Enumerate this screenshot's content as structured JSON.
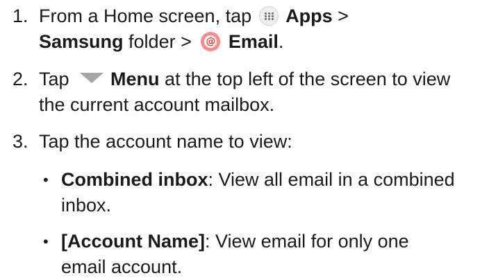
{
  "steps": [
    {
      "number": "1.",
      "line1": {
        "t1": "From a Home screen, tap ",
        "apps_label": "Apps",
        "t2": " >"
      },
      "line2": {
        "samsung_label": "Samsung",
        "t3": " folder > ",
        "email_label": "Email",
        "t4": "."
      },
      "icons": [
        "apps-grid-icon",
        "email-at-icon"
      ]
    },
    {
      "number": "2.",
      "line1": {
        "t1": "Tap ",
        "menu_label": "Menu",
        "t2": " at the top left of the screen to view"
      },
      "line2": "the current account mailbox.",
      "icons": [
        "menu-triangle-icon"
      ]
    },
    {
      "number": "3.",
      "line1": "Tap the account name to view:"
    }
  ],
  "bullets": [
    {
      "marker": "•",
      "term": "Combined inbox",
      "line1_rest": ": View all email in a combined",
      "line2": "inbox."
    },
    {
      "marker": "•",
      "term": "[Account Name]",
      "line1_rest": ": View email for only one",
      "line2": "email account."
    }
  ],
  "colors": {
    "text": "#1a1a1a",
    "email_icon": "#ff8a8a",
    "menu_icon": "#a6a6a6"
  }
}
